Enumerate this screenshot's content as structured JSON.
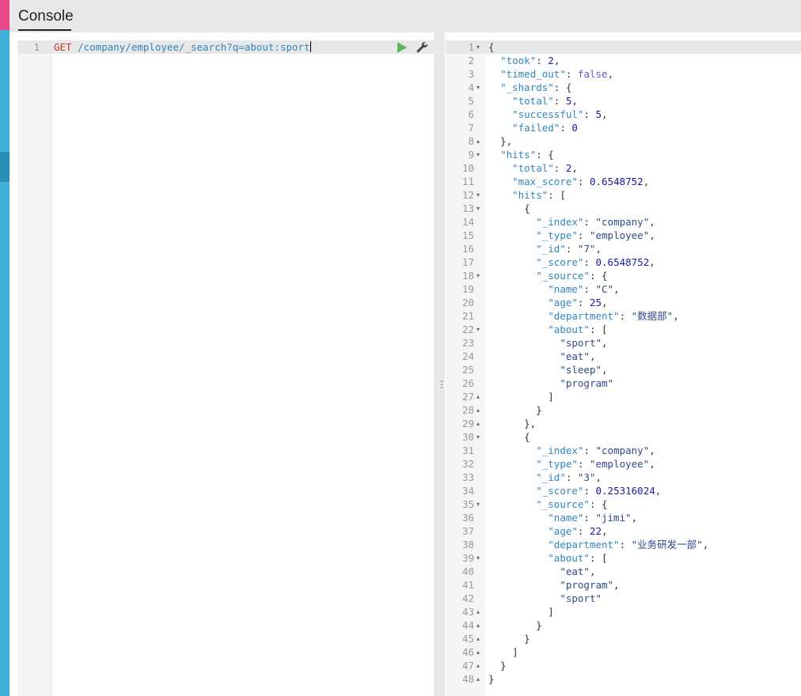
{
  "app": {
    "tab_label": "Console"
  },
  "request": {
    "line_number": "1",
    "method": "GET",
    "url": " /company/employee/_search?q=about:sport",
    "run_icon": "play-icon",
    "settings_icon": "wrench-icon"
  },
  "divider": {
    "handle_icon": "vertical-dots-icon",
    "handle_glyph": "⋮"
  },
  "response": {
    "lines": [
      "{",
      "  \"took\": 2,",
      "  \"timed_out\": false,",
      "  \"_shards\": {",
      "    \"total\": 5,",
      "    \"successful\": 5,",
      "    \"failed\": 0",
      "  },",
      "  \"hits\": {",
      "    \"total\": 2,",
      "    \"max_score\": 0.6548752,",
      "    \"hits\": [",
      "      {",
      "        \"_index\": \"company\",",
      "        \"_type\": \"employee\",",
      "        \"_id\": \"7\",",
      "        \"_score\": 0.6548752,",
      "        \"_source\": {",
      "          \"name\": \"C\",",
      "          \"age\": 25,",
      "          \"department\": \"数据部\",",
      "          \"about\": [",
      "            \"sport\",",
      "            \"eat\",",
      "            \"sleep\",",
      "            \"program\"",
      "          ]",
      "        }",
      "      },",
      "      {",
      "        \"_index\": \"company\",",
      "        \"_type\": \"employee\",",
      "        \"_id\": \"3\",",
      "        \"_score\": 0.25316024,",
      "        \"_source\": {",
      "          \"name\": \"jimi\",",
      "          \"age\": 22,",
      "          \"department\": \"业务研发一部\",",
      "          \"about\": [",
      "            \"eat\",",
      "            \"program\",",
      "            \"sport\"",
      "          ]",
      "        }",
      "      }",
      "    ]",
      "  }",
      "}"
    ],
    "fold_open_glyph": "▾",
    "fold_close_glyph": "▴",
    "fold_open_lines": [
      1,
      4,
      9,
      12,
      13,
      18,
      22,
      30,
      35,
      39
    ],
    "fold_close_lines": [
      8,
      27,
      28,
      29,
      43,
      44,
      45,
      46,
      47,
      48
    ]
  }
}
